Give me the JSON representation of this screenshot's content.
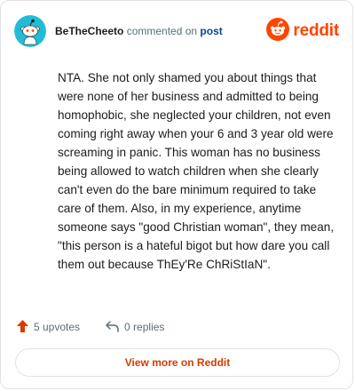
{
  "header": {
    "username": "BeTheCheeto",
    "action_text": "commented on",
    "post_link": "post",
    "brand": "reddit"
  },
  "comment": {
    "text": "NTA. She not only shamed you about things that were none of her business and admitted to being homophobic, she neglected your children, not even coming right away when your 6 and 3 year old were screaming in panic. This woman has no business being allowed to watch children when she clearly can't even do the bare minimum required to take care of them. Also, in my experience, anytime someone says \"good Christian woman\", they mean, \"this person is a hateful bigot but how dare you call them out because ThEy'Re ChRiStIaN\"."
  },
  "stats": {
    "upvotes": "5 upvotes",
    "replies": "0 replies"
  },
  "footer": {
    "view_more": "View more on Reddit"
  },
  "colors": {
    "brand": "#ff4500",
    "avatar_bg": "#22bcd6",
    "link": "#0a449b",
    "upvote": "#d93a00"
  },
  "icons": {
    "avatar": "snoo-avatar-icon",
    "logo": "reddit-logo-icon",
    "upvote": "upvote-arrow-icon",
    "reply": "reply-arrow-icon"
  }
}
